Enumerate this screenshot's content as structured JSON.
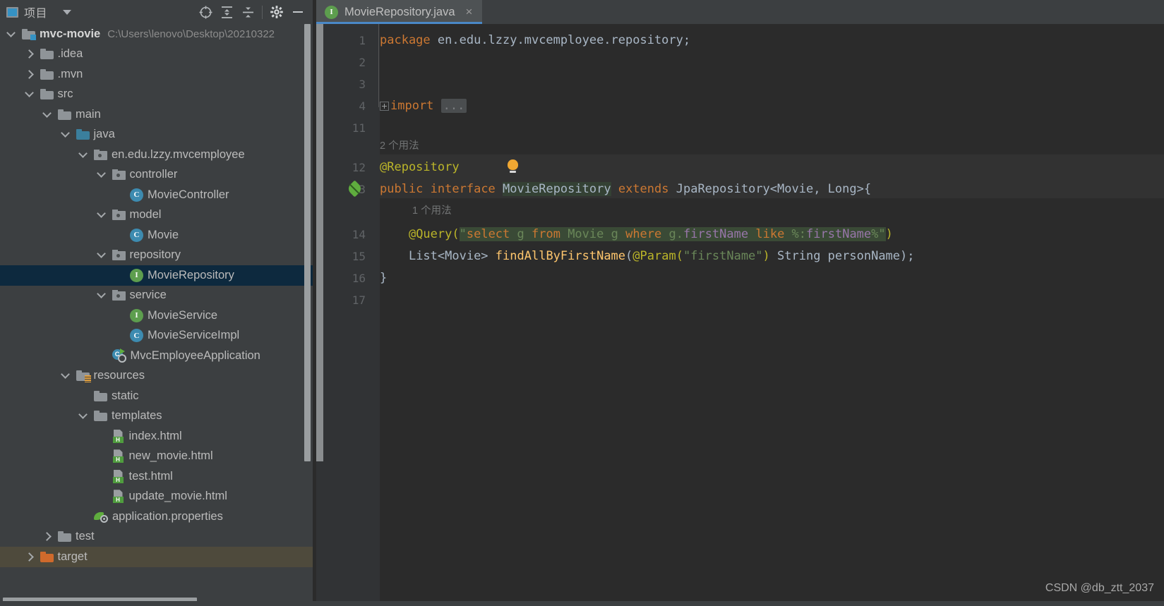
{
  "tool_window": {
    "title": "项目",
    "icon": "project-view-icon",
    "caret": "chevron-down-icon",
    "actions": [
      {
        "name": "select-opened-file-icon",
        "label": "⊕"
      },
      {
        "name": "expand-all-icon",
        "label": "expand"
      },
      {
        "name": "collapse-all-icon",
        "label": "collapse"
      },
      {
        "name": "settings-gear-icon",
        "label": "gear"
      },
      {
        "name": "hide-tool-window-icon",
        "label": "—"
      }
    ]
  },
  "tree": {
    "nodes": [
      {
        "label": "mvc-movie",
        "path": "C:\\Users\\lenovo\\Desktop\\20210322",
        "depth": 0,
        "arrow": "open",
        "icon": "module-folder",
        "bold": true,
        "state": "normal"
      },
      {
        "label": ".idea",
        "depth": 1,
        "arrow": "closed",
        "icon": "folder",
        "state": "normal"
      },
      {
        "label": ".mvn",
        "depth": 1,
        "arrow": "closed",
        "icon": "folder",
        "state": "normal"
      },
      {
        "label": "src",
        "depth": 1,
        "arrow": "open",
        "icon": "folder",
        "state": "normal"
      },
      {
        "label": "main",
        "depth": 2,
        "arrow": "open",
        "icon": "folder",
        "state": "normal"
      },
      {
        "label": "java",
        "depth": 3,
        "arrow": "open",
        "icon": "source-folder",
        "state": "normal"
      },
      {
        "label": "en.edu.lzzy.mvcemployee",
        "depth": 4,
        "arrow": "open",
        "icon": "package",
        "state": "normal"
      },
      {
        "label": "controller",
        "depth": 5,
        "arrow": "open",
        "icon": "package",
        "state": "normal"
      },
      {
        "label": "MovieController",
        "depth": 6,
        "arrow": "none",
        "icon": "class",
        "state": "normal"
      },
      {
        "label": "model",
        "depth": 5,
        "arrow": "open",
        "icon": "package",
        "state": "normal"
      },
      {
        "label": "Movie",
        "depth": 6,
        "arrow": "none",
        "icon": "class",
        "state": "normal"
      },
      {
        "label": "repository",
        "depth": 5,
        "arrow": "open",
        "icon": "package",
        "state": "normal"
      },
      {
        "label": "MovieRepository",
        "depth": 6,
        "arrow": "none",
        "icon": "interface",
        "state": "selected"
      },
      {
        "label": "service",
        "depth": 5,
        "arrow": "open",
        "icon": "package",
        "state": "normal"
      },
      {
        "label": "MovieService",
        "depth": 6,
        "arrow": "none",
        "icon": "interface",
        "state": "normal"
      },
      {
        "label": "MovieServiceImpl",
        "depth": 6,
        "arrow": "none",
        "icon": "class",
        "state": "normal"
      },
      {
        "label": "MvcEmployeeApplication",
        "depth": 5,
        "arrow": "none",
        "icon": "spring-boot-app",
        "state": "normal"
      },
      {
        "label": "resources",
        "depth": 3,
        "arrow": "open",
        "icon": "resources-folder",
        "state": "normal"
      },
      {
        "label": "static",
        "depth": 4,
        "arrow": "none",
        "icon": "folder",
        "state": "normal"
      },
      {
        "label": "templates",
        "depth": 4,
        "arrow": "open",
        "icon": "folder",
        "state": "normal"
      },
      {
        "label": "index.html",
        "depth": 5,
        "arrow": "none",
        "icon": "html-file",
        "state": "normal"
      },
      {
        "label": "new_movie.html",
        "depth": 5,
        "arrow": "none",
        "icon": "html-file",
        "state": "normal"
      },
      {
        "label": "test.html",
        "depth": 5,
        "arrow": "none",
        "icon": "html-file",
        "state": "normal"
      },
      {
        "label": "update_movie.html",
        "depth": 5,
        "arrow": "none",
        "icon": "html-file",
        "state": "normal"
      },
      {
        "label": "application.properties",
        "depth": 4,
        "arrow": "none",
        "icon": "spring-properties",
        "state": "normal"
      },
      {
        "label": "test",
        "depth": 2,
        "arrow": "closed",
        "icon": "folder",
        "state": "normal"
      },
      {
        "label": "target",
        "depth": 1,
        "arrow": "closed",
        "icon": "excluded-folder",
        "state": "hovered"
      }
    ]
  },
  "editor": {
    "tab": {
      "filename": "MovieRepository.java",
      "icon": "interface-icon",
      "close": "×",
      "active": true
    },
    "line_numbers": [
      "1",
      "2",
      "3",
      "4",
      "11",
      "12",
      "13",
      "14",
      "15",
      "16",
      "17"
    ],
    "gutter_icons": [
      {
        "line": "13",
        "name": "spring-bean-gutter-icon"
      }
    ],
    "intention_bulb": {
      "line": "12",
      "name": "intention-bulb-icon"
    },
    "usage_hints": [
      {
        "text": "2 个用法",
        "above_line": "12"
      },
      {
        "text": "1 个用法",
        "above_line": "14"
      }
    ],
    "code_lines": [
      {
        "n": "1",
        "text": "package en.edu.lzzy.mvcemployee.repository;"
      },
      {
        "n": "2",
        "text": ""
      },
      {
        "n": "3",
        "text": ""
      },
      {
        "n": "4",
        "text": "import ..."
      },
      {
        "n": "11",
        "text": ""
      },
      {
        "n": "12",
        "text": "@Repository"
      },
      {
        "n": "13",
        "text": "public interface MovieRepository extends JpaRepository<Movie, Long>{"
      },
      {
        "n": "14",
        "text": "    @Query(\"select g from Movie g where g.firstName like %:firstName%\")"
      },
      {
        "n": "15",
        "text": "    List<Movie> findAllByFirstName(@Param(\"firstName\") String personName);"
      },
      {
        "n": "16",
        "text": "}"
      },
      {
        "n": "17",
        "text": ""
      }
    ],
    "fold_placeholder": "...",
    "watermark": "CSDN @db_ztt_2037"
  },
  "colors": {
    "panel_bg": "#3c3f41",
    "editor_bg": "#2b2b2b",
    "gutter_bg": "#313335",
    "selection": "#0d293e",
    "hover": "#4e4a3c",
    "tab_active": "#4e5254",
    "tab_underline": "#4a88c7",
    "keyword": "#cc7832",
    "annotation": "#bbb529",
    "string": "#6a8759",
    "field": "#9876aa",
    "method": "#ffc66d",
    "identifier": "#a9b7c6",
    "spring_green": "#5fad3e"
  }
}
